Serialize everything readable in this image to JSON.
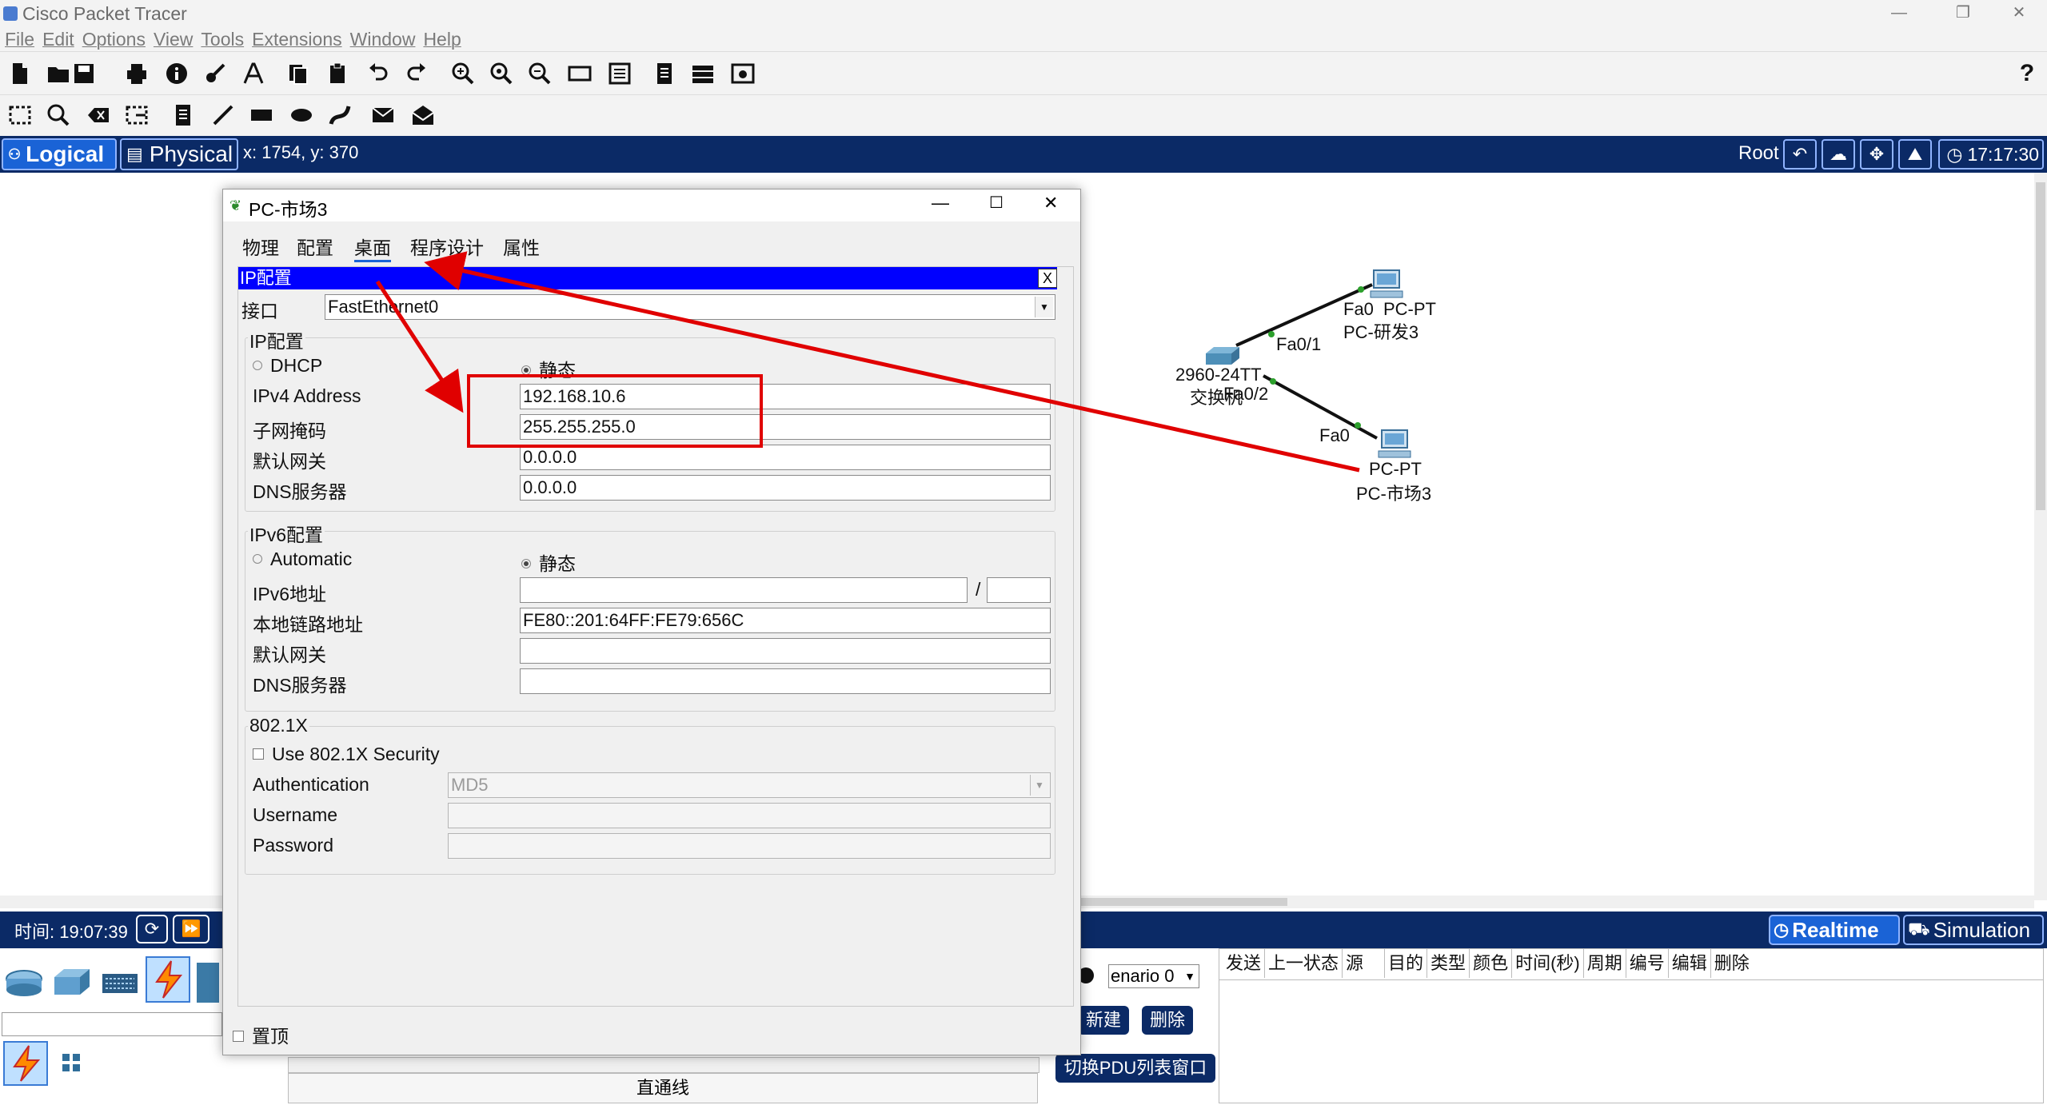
{
  "window": {
    "title": "Cisco Packet Tracer",
    "controls": [
      "—",
      "❐",
      "✕"
    ]
  },
  "menu": [
    "File",
    "Edit",
    "Options",
    "View",
    "Tools",
    "Extensions",
    "Window",
    "Help"
  ],
  "toolbar": {
    "help": "?"
  },
  "nav": {
    "logical": "Logical",
    "physical": "Physical",
    "coords": "x: 1754, y: 370",
    "root": "Root",
    "clock": "17:17:30"
  },
  "topology": {
    "switch": {
      "model": "2960-24TT",
      "name": "交换机",
      "port1": "Fa0/1",
      "port2": "Fa0/2"
    },
    "pc_rd": {
      "type": "PC-PT",
      "name": "PC-研发3",
      "port": "Fa0"
    },
    "pc_market": {
      "type": "PC-PT",
      "name": "PC-市场3",
      "port": "Fa0"
    }
  },
  "dialog": {
    "title": "PC-市场3",
    "tabs": [
      "物理",
      "配置",
      "桌面",
      "程序设计",
      "属性"
    ],
    "active_tab": "桌面",
    "panel_title": "IP配置",
    "panel_close": "X",
    "interface_label": "接口",
    "interface_value": "FastEthernet0",
    "ipv4": {
      "legend": "IP配置",
      "dhcp": "DHCP",
      "static": "静态",
      "address_label": "IPv4 Address",
      "address": "192.168.10.6",
      "mask_label": "子网掩码",
      "mask": "255.255.255.0",
      "gateway_label": "默认网关",
      "gateway": "0.0.0.0",
      "dns_label": "DNS服务器",
      "dns": "0.0.0.0"
    },
    "ipv6": {
      "legend": "IPv6配置",
      "auto": "Automatic",
      "static": "静态",
      "address_label": "IPv6地址",
      "address": "",
      "slash": "/",
      "prefix": "",
      "linklocal_label": "本地链路地址",
      "linklocal": "FE80::201:64FF:FE79:656C",
      "gateway_label": "默认网关",
      "gateway": "",
      "dns_label": "DNS服务器",
      "dns": ""
    },
    "dot1x": {
      "legend": "802.1X",
      "use": "Use 802.1X Security",
      "auth_label": "Authentication",
      "auth_value": "MD5",
      "user_label": "Username",
      "user": "",
      "pass_label": "Password",
      "pass": ""
    },
    "on_top": "置顶",
    "controls": [
      "—",
      "☐",
      "✕"
    ]
  },
  "bottom": {
    "time": "时间: 19:07:39",
    "realtime": "Realtime",
    "simulation": "Simulation",
    "scenario": "enario 0",
    "new": "新建",
    "delete": "删除",
    "toggle_pdu": "切换PDU列表窗口",
    "pdu_columns": [
      "发送",
      "上一状态",
      "源",
      "目的",
      "类型",
      "颜色",
      "时间(秒)",
      "周期",
      "编号",
      "编辑",
      "删除"
    ],
    "cable_label": "直通线"
  },
  "colors": {
    "nav_bg": "#0b2a66",
    "active_blue": "#1a63d6",
    "panel_title_bg": "#0000ff",
    "annotation_red": "#e00000"
  }
}
